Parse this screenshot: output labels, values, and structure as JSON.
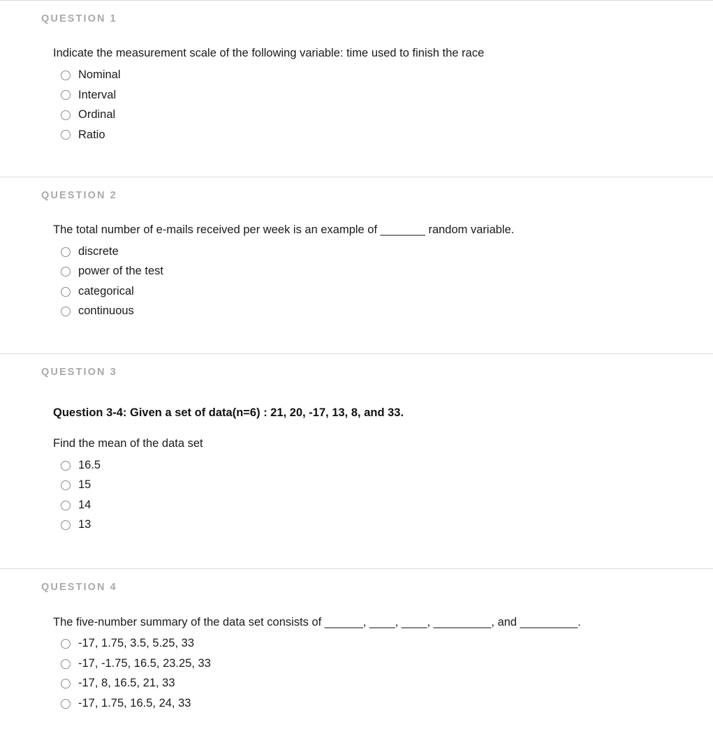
{
  "questions": [
    {
      "header": "QUESTION 1",
      "preamble": "",
      "text": "Indicate the measurement scale of the following variable: time used to finish the race",
      "options": [
        "Nominal",
        "Interval",
        "Ordinal",
        "Ratio"
      ]
    },
    {
      "header": "QUESTION 2",
      "preamble": "",
      "text": "The total number of e-mails received per week is an example of _______ random variable.",
      "options": [
        "discrete",
        "power of the test",
        "categorical",
        "continuous"
      ]
    },
    {
      "header": "QUESTION 3",
      "preamble": "Question 3-4: Given a set of data(n=6) : 21, 20, -17, 13, 8, and 33.",
      "text": "Find the mean of the data set",
      "options": [
        "16.5",
        "15",
        "14",
        "13"
      ]
    },
    {
      "header": "QUESTION 4",
      "preamble": "",
      "text": "The five-number summary of the data set consists of ______, ____, ____, _________, and _________.",
      "options": [
        "-17, 1.75, 3.5, 5.25, 33",
        "-17, -1.75, 16.5, 23.25, 33",
        "-17, 8, 16.5, 21, 33",
        "-17, 1.75, 16.5, 24, 33"
      ]
    }
  ],
  "colors": {
    "header_gray": "#a9a9a9",
    "rule_gray": "#d9d9d9",
    "text_dark": "#1a1a1a",
    "radio_border": "#8d8d8d"
  }
}
